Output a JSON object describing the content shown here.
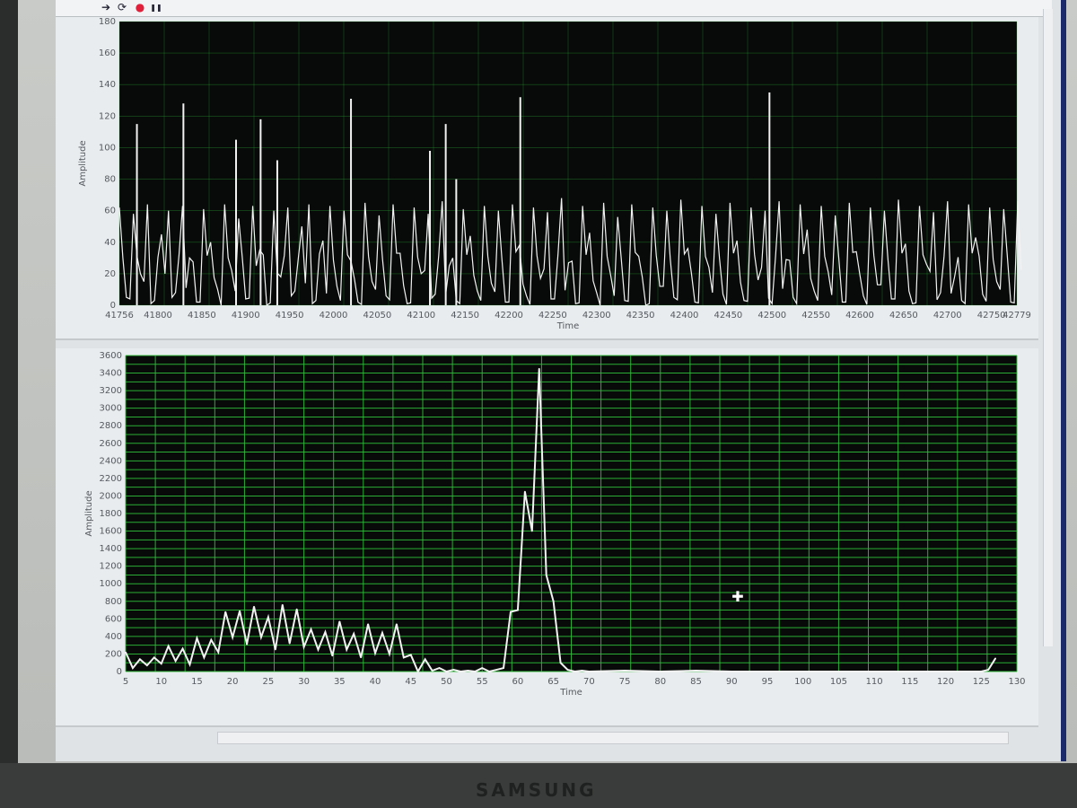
{
  "toolbar": {
    "icons": [
      "run-arrow-icon",
      "run-continuous-icon",
      "abort-icon",
      "pause-icon"
    ],
    "glyphs": [
      "➔",
      "⟳",
      "●",
      "❚❚"
    ]
  },
  "brand": "SAMSUNG",
  "colors": {
    "plot_bg": "#070a08",
    "grid": "#2fbf3a",
    "trace": "#f2f2f2",
    "abort": "#e0203a"
  },
  "chart_data": [
    {
      "type": "line",
      "xlabel": "Time",
      "ylabel": "Amplitude",
      "xlim": [
        41756,
        42779
      ],
      "ylim": [
        0,
        180
      ],
      "x_ticks": [
        "41756",
        "41800",
        "41850",
        "41900",
        "41950",
        "42000",
        "42050",
        "42100",
        "42150",
        "42200",
        "42250",
        "42300",
        "42350",
        "42400",
        "42450",
        "42500",
        "42550",
        "42600",
        "42650",
        "42700",
        "42750",
        "42779"
      ],
      "y_ticks": [
        "0",
        "20",
        "40",
        "60",
        "80",
        "100",
        "120",
        "140",
        "160",
        "180"
      ],
      "grid": true,
      "noise_step": 8,
      "noise_values": [
        62,
        5,
        58,
        20,
        64,
        3,
        45,
        60,
        8,
        63,
        30,
        2,
        61,
        40,
        10,
        64,
        22,
        55,
        4,
        63,
        35,
        0,
        60,
        18,
        62,
        9,
        50,
        64,
        3,
        41,
        63,
        12,
        60,
        28,
        2,
        65,
        15,
        57,
        6,
        64,
        33,
        1,
        62,
        20,
        58,
        7,
        66,
        25,
        3,
        61,
        44,
        9,
        63,
        14,
        60,
        2,
        64,
        38,
        6,
        62,
        17,
        59,
        4,
        68,
        27,
        1,
        63,
        46,
        8,
        65,
        19,
        56,
        3,
        64,
        31,
        0,
        62,
        12,
        60,
        5,
        67,
        36,
        2,
        63,
        24,
        58,
        7,
        65,
        41,
        3,
        62,
        16,
        60,
        1,
        66,
        29,
        5,
        64,
        48,
        9,
        63,
        21,
        57,
        2,
        65,
        34,
        6,
        62,
        13,
        60,
        4,
        67,
        39,
        1,
        63,
        26,
        59,
        8,
        66,
        18,
        3,
        64,
        43,
        7,
        62,
        15,
        61,
        2,
        66
      ],
      "spikes": [
        {
          "x": 41776,
          "y": 115
        },
        {
          "x": 41829,
          "y": 128
        },
        {
          "x": 41889,
          "y": 105
        },
        {
          "x": 41917,
          "y": 118
        },
        {
          "x": 41936,
          "y": 92
        },
        {
          "x": 42020,
          "y": 131
        },
        {
          "x": 42110,
          "y": 98
        },
        {
          "x": 42128,
          "y": 115
        },
        {
          "x": 42140,
          "y": 80
        },
        {
          "x": 42213,
          "y": 132
        },
        {
          "x": 42497,
          "y": 135
        }
      ]
    },
    {
      "type": "line",
      "xlabel": "Time",
      "ylabel": "Amplitude",
      "xlim": [
        5,
        130
      ],
      "ylim": [
        0,
        3600
      ],
      "x_ticks": [
        "5",
        "10",
        "15",
        "20",
        "25",
        "30",
        "35",
        "40",
        "45",
        "50",
        "55",
        "60",
        "65",
        "70",
        "75",
        "80",
        "85",
        "90",
        "95",
        "100",
        "105",
        "110",
        "115",
        "120",
        "125",
        "130"
      ],
      "y_ticks": [
        "0",
        "200",
        "400",
        "600",
        "800",
        "1000",
        "1200",
        "1400",
        "1600",
        "1800",
        "2000",
        "2200",
        "2400",
        "2600",
        "2800",
        "3000",
        "3200",
        "3400",
        "3600"
      ],
      "grid": true,
      "x": [
        5,
        6,
        7,
        8,
        9,
        10,
        11,
        12,
        13,
        14,
        15,
        16,
        17,
        18,
        19,
        20,
        21,
        22,
        23,
        24,
        25,
        26,
        27,
        28,
        29,
        30,
        31,
        32,
        33,
        34,
        35,
        36,
        37,
        38,
        39,
        40,
        41,
        42,
        43,
        44,
        45,
        46,
        47,
        48,
        49,
        50,
        51,
        52,
        53,
        54,
        55,
        56,
        57,
        58,
        59,
        60,
        61,
        62,
        63,
        64,
        65,
        66,
        67,
        68,
        69,
        70,
        75,
        80,
        85,
        90,
        95,
        100,
        105,
        110,
        115,
        120,
        125,
        126,
        127
      ],
      "y": [
        220,
        40,
        140,
        70,
        160,
        90,
        290,
        120,
        260,
        80,
        380,
        160,
        360,
        220,
        680,
        390,
        690,
        310,
        740,
        390,
        620,
        250,
        760,
        320,
        710,
        280,
        480,
        250,
        450,
        180,
        570,
        250,
        430,
        160,
        540,
        210,
        440,
        200,
        540,
        160,
        190,
        0,
        140,
        10,
        40,
        0,
        20,
        0,
        10,
        0,
        40,
        0,
        20,
        40,
        680,
        700,
        2050,
        1600,
        3450,
        1100,
        800,
        100,
        20,
        0,
        10,
        0,
        10,
        0,
        10,
        0,
        0,
        0,
        0,
        0,
        0,
        0,
        0,
        20,
        150
      ]
    }
  ]
}
